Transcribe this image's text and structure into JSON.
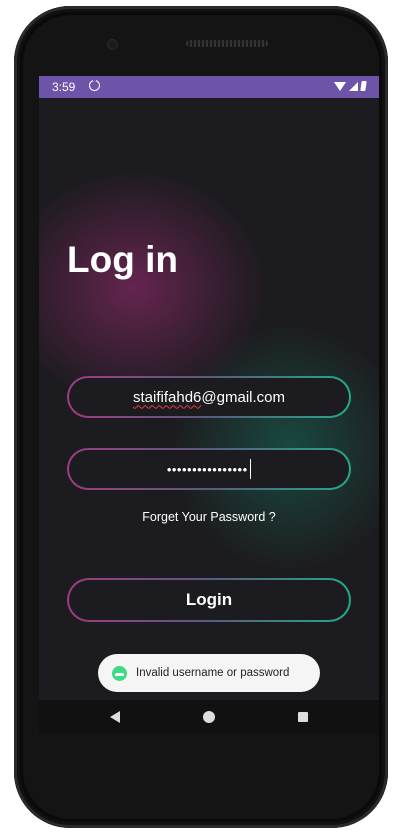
{
  "status_bar": {
    "time": "3:59"
  },
  "login": {
    "title": "Log in",
    "email_prefix": "staififahd6",
    "email_suffix": "@gmail.com",
    "password_masked": "••••••••••••••••",
    "forgot_password": "Forget Your Password ?",
    "login_button": "Login"
  },
  "toast": {
    "message": "Invalid username or password"
  },
  "icons": {
    "status": [
      "sync-icon",
      "wifi-icon",
      "signal-icon",
      "battery-icon"
    ],
    "toast": "android-icon",
    "navigation": [
      "back-icon",
      "home-icon",
      "recents-icon"
    ]
  },
  "colors": {
    "status_bar": "#6e54a8",
    "background": "#1c1b1f",
    "border_start": "#9e3c80",
    "border_end": "#23a988",
    "toast_background": "#f5f5f5",
    "toast_icon": "#3ddc84"
  }
}
